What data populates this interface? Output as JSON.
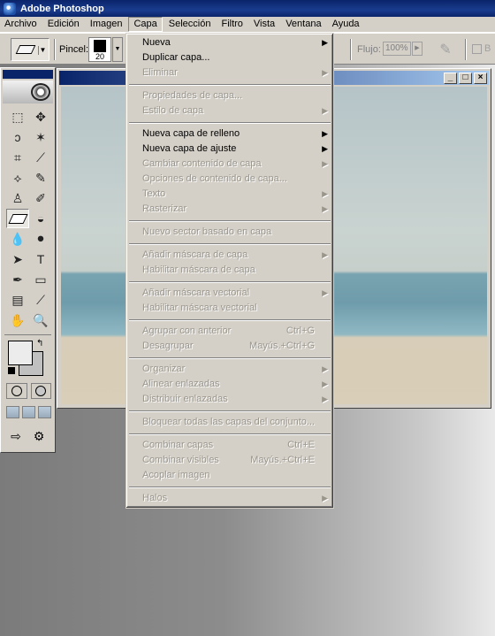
{
  "app": {
    "title": "Adobe Photoshop"
  },
  "menubar": {
    "items": [
      "Archivo",
      "Edición",
      "Imagen",
      "Capa",
      "Selección",
      "Filtro",
      "Vista",
      "Ventana",
      "Ayuda"
    ],
    "active": "Capa"
  },
  "options": {
    "brush_label": "Pincel:",
    "brush_size": "20",
    "flow_label": "Flujo:",
    "flow_value": "100%",
    "check_label": "B"
  },
  "capa_menu": {
    "groups": [
      [
        {
          "label": "Nueva",
          "enabled": true,
          "submenu": true
        },
        {
          "label": "Duplicar capa...",
          "enabled": true
        },
        {
          "label": "Eliminar",
          "enabled": false,
          "submenu": true
        }
      ],
      [
        {
          "label": "Propiedades de capa...",
          "enabled": false
        },
        {
          "label": "Estilo de capa",
          "enabled": false,
          "submenu": true
        }
      ],
      [
        {
          "label": "Nueva capa de relleno",
          "enabled": true,
          "submenu": true
        },
        {
          "label": "Nueva capa de ajuste",
          "enabled": true,
          "submenu": true
        },
        {
          "label": "Cambiar contenido de capa",
          "enabled": false,
          "submenu": true
        },
        {
          "label": "Opciones de contenido de capa...",
          "enabled": false
        },
        {
          "label": "Texto",
          "enabled": false,
          "submenu": true
        },
        {
          "label": "Rasterizar",
          "enabled": false,
          "submenu": true
        }
      ],
      [
        {
          "label": "Nuevo sector basado en capa",
          "enabled": false
        }
      ],
      [
        {
          "label": "Añadir máscara de capa",
          "enabled": false,
          "submenu": true
        },
        {
          "label": "Habilitar máscara de capa",
          "enabled": false
        }
      ],
      [
        {
          "label": "Añadir máscara vectorial",
          "enabled": false,
          "submenu": true
        },
        {
          "label": "Habilitar máscara vectorial",
          "enabled": false
        }
      ],
      [
        {
          "label": "Agrupar con anterior",
          "enabled": false,
          "shortcut": "Ctrl+G"
        },
        {
          "label": "Desagrupar",
          "enabled": false,
          "shortcut": "Mayús.+Ctrl+G"
        }
      ],
      [
        {
          "label": "Organizar",
          "enabled": false,
          "submenu": true
        },
        {
          "label": "Alinear enlazadas",
          "enabled": false,
          "submenu": true
        },
        {
          "label": "Distribuir enlazadas",
          "enabled": false,
          "submenu": true
        }
      ],
      [
        {
          "label": "Bloquear todas las capas del conjunto...",
          "enabled": false
        }
      ],
      [
        {
          "label": "Combinar capas",
          "enabled": false,
          "shortcut": "Ctrl+E"
        },
        {
          "label": "Combinar visibles",
          "enabled": false,
          "shortcut": "Mayús.+Ctrl+E"
        },
        {
          "label": "Acoplar imagen",
          "enabled": false
        }
      ],
      [
        {
          "label": "Halos",
          "enabled": false,
          "submenu": true
        }
      ]
    ]
  },
  "doc_window": {
    "buttons": [
      "_",
      "□",
      "×"
    ]
  },
  "toolbox": {
    "tools": [
      [
        "marquee-icon",
        "move-icon"
      ],
      [
        "lasso-icon",
        "magic-wand-icon"
      ],
      [
        "crop-icon",
        "slice-icon"
      ],
      [
        "healing-brush-icon",
        "brush-icon"
      ],
      [
        "clone-stamp-icon",
        "history-brush-icon"
      ],
      [
        "eraser-icon",
        "paint-bucket-icon"
      ],
      [
        "blur-icon",
        "dodge-icon"
      ],
      [
        "path-selection-icon",
        "type-icon"
      ],
      [
        "pen-icon",
        "rectangle-icon"
      ],
      [
        "notes-icon",
        "eyedropper-icon"
      ],
      [
        "hand-icon",
        "zoom-icon"
      ]
    ],
    "tool_glyphs": [
      [
        "⬚",
        "✥"
      ],
      [
        "ↄ",
        "✶"
      ],
      [
        "⌗",
        "⟋"
      ],
      [
        "⟡",
        "✎"
      ],
      [
        "♙",
        "✐"
      ],
      [
        "",
        "◒"
      ],
      [
        "💧",
        "⚫"
      ],
      [
        "➤",
        "T"
      ],
      [
        "✒",
        "▭"
      ],
      [
        "▤",
        "⟋"
      ],
      [
        "✋",
        "🔍"
      ]
    ],
    "selected_tool": "eraser-icon"
  }
}
